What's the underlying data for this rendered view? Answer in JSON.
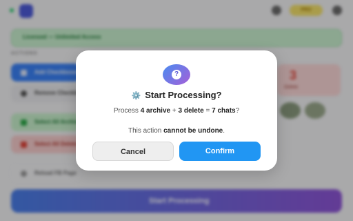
{
  "background": {
    "pro_badge": "PRO",
    "license_text": "Licensed — Unlimited Access",
    "section_label": "ACTIONS",
    "actions": [
      {
        "label": "Add Checkboxes",
        "color": "#3b82f6"
      },
      {
        "label": "Remove Checkboxes",
        "color": "#e5e5e5"
      },
      {
        "label": "Select All Archive",
        "color": "#c8f0cc"
      },
      {
        "label": "Select All Delete",
        "color": "#f6cccc"
      },
      {
        "label": "Reload FB Page",
        "color": "#f2f2f4"
      }
    ],
    "stat_value": "3",
    "stat_label": "Delete",
    "start_button": "Start Processing"
  },
  "modal": {
    "icon": "question-icon",
    "icon_glyph": "?",
    "title_icon": "gear-icon",
    "title_glyph": "⚙️",
    "title": "Start Processing?",
    "summary": {
      "prefix": "Process ",
      "archive": "4 archive",
      "plus": " + ",
      "delete": "3 delete",
      "equals": " = ",
      "total": "7 chats",
      "suffix": "?"
    },
    "warning": {
      "prefix": "This action ",
      "emphasis": "cannot be undone",
      "suffix": "."
    },
    "cancel_label": "Cancel",
    "confirm_label": "Confirm"
  },
  "colors": {
    "confirm": "#2196f3",
    "icon_gradient_start": "#4a8cf0",
    "icon_gradient_end": "#a55fd8"
  }
}
